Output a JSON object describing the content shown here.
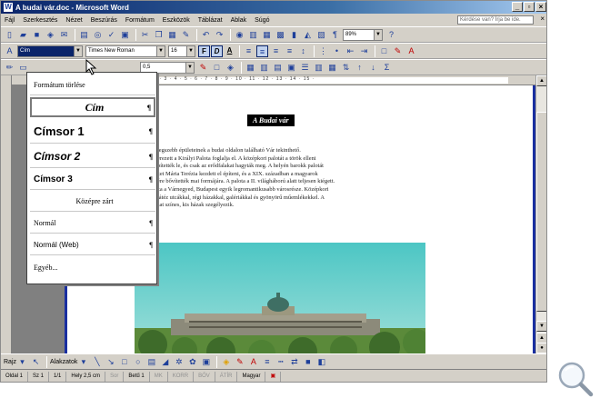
{
  "window": {
    "title": "A budai vár.doc - Microsoft Word",
    "controls": [
      "_",
      "▫",
      "×"
    ]
  },
  "menubar": {
    "items": [
      "Fájl",
      "Szerkesztés",
      "Nézet",
      "Beszúrás",
      "Formátum",
      "Eszközök",
      "Táblázat",
      "Ablak",
      "Súgó"
    ],
    "help_placeholder": "Kérdése van? Írja be ide."
  },
  "toolbar_standard": {
    "zoom": "89%"
  },
  "toolbar_formatting": {
    "style_value": "Cím",
    "font_value": "Times New Roman",
    "size_value": "16",
    "bold_label": "F",
    "italic_label": "D",
    "underline_label": "A"
  },
  "toolbar_tables": {
    "line_width": "0,5"
  },
  "ruler": {
    "ticks": "· 1 · 2 · 3 · 4 · 5 · 6 · 7 · 8 · 9 · 10 · 11 · 12 · 13 · 14 · 15 ·"
  },
  "style_dropdown": {
    "items": [
      {
        "label": "Formátum törlése",
        "pilcrow": false
      },
      {
        "label": "Cím",
        "pilcrow": true
      },
      {
        "label": "Címsor 1",
        "pilcrow": true
      },
      {
        "label": "Címsor 2",
        "pilcrow": true
      },
      {
        "label": "Címsor 3",
        "pilcrow": true
      },
      {
        "label": "Középre zárt",
        "pilcrow": false
      },
      {
        "label": "Normál",
        "pilcrow": true
      },
      {
        "label": "Normál (Web)",
        "pilcrow": true
      },
      {
        "label": "Egyéb...",
        "pilcrow": false
      }
    ],
    "pilcrow_char": "¶"
  },
  "document": {
    "heading": "A Budai vár",
    "lines": [
      "legszebb épületeinek a budai oldalon található Vár tekinthető.",
      "erezett a Királyi Palota foglalja el. A középkori palotát a török elleni",
      "pítették le, és csak az erődfalakat hagyták meg. A helyén barokk palotát",
      "zet Mária Terézia kezdett el építeni, és a XIX. században a magyarok",
      "ére bővítették mai formájára. A palota a II. világháború alatt teljesen kiégett.",
      "za a Várnegyed, Budapest egyik legromantikusabb városrésze. Középkori",
      "látéz utcákkal, régi házakkal, galériákkal és gyönyörű műemlékekkel. A",
      "sat színes, kis házak szegélyezik."
    ]
  },
  "drawing_toolbar": {
    "draw_label": "Rajz",
    "autoshapes_label": "Alakzatok"
  },
  "statusbar": {
    "page": "Oldal 1",
    "section": "Sz 1",
    "pages": "1/1",
    "position": "Hely 2,5 cm",
    "line": "Sor",
    "column": "Betű 1",
    "rec": "MK",
    "trk": "KORR",
    "ext": "BŐV",
    "ovr": "ÁTÍR",
    "language": "Magyar"
  },
  "colors": {
    "titlebar": "#0a246a",
    "chrome": "#d4d0c8",
    "page_border": "#1a2fa0"
  }
}
